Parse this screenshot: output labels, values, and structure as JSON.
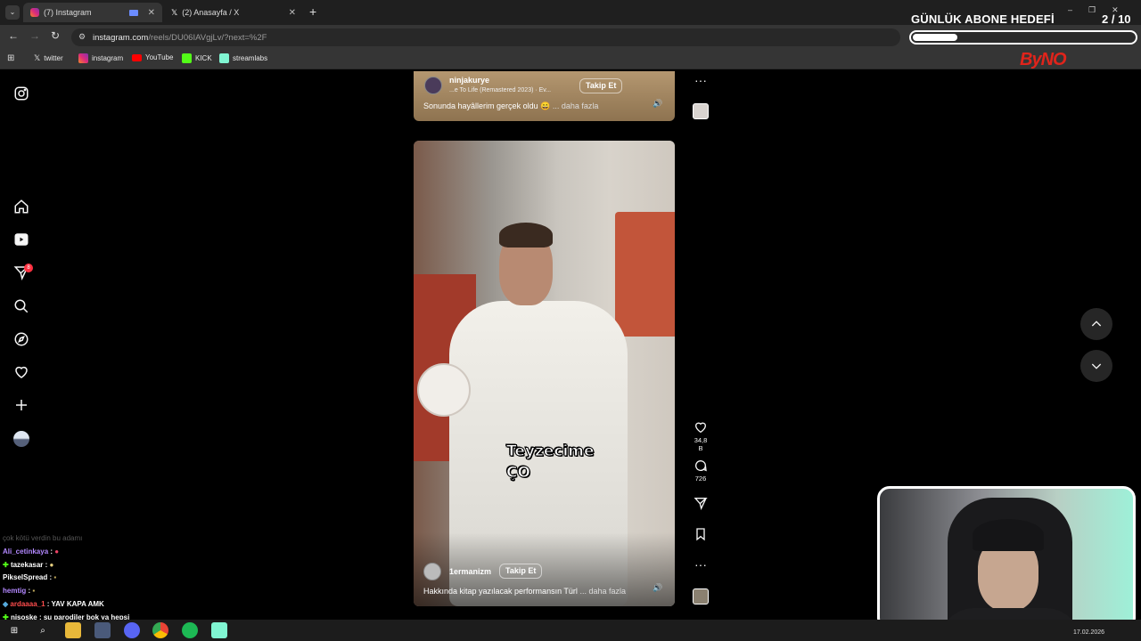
{
  "browser": {
    "tabs": [
      {
        "title": "(7) Instagram",
        "icon": "instagram-icon",
        "active": true
      },
      {
        "title": "(2) Anasayfa / X",
        "icon": "x-icon",
        "active": false
      }
    ],
    "url_host": "instagram.com",
    "url_path": "/reels/DU06IAVgjLv/?next=%2F",
    "bookmarks": [
      {
        "label": "twitter",
        "icon": "x-icon",
        "color": "#000000"
      },
      {
        "label": "instagram",
        "icon": "instagram-icon",
        "color": "#d62976"
      },
      {
        "label": "YouTube",
        "icon": "youtube-icon",
        "color": "#ff0000"
      },
      {
        "label": "KICK",
        "icon": "kick-icon",
        "color": "#53fc18"
      },
      {
        "label": "streamlabs",
        "icon": "streamlabs-icon",
        "color": "#80f5d2"
      }
    ]
  },
  "overlay": {
    "goal_title": "GÜNLÜK ABONE HEDEFİ",
    "goal_count": "2  / 10",
    "goal_progress": 0.2,
    "logo": "ByNO"
  },
  "sidebar": {
    "notification_count": "8",
    "items": [
      "instagram-logo-icon",
      "home-icon",
      "reels-icon",
      "send-icon",
      "search-icon",
      "explore-icon",
      "heart-icon",
      "plus-icon",
      "profile-avatar"
    ]
  },
  "reel_top": {
    "author": "ninjakurye",
    "audio": "...e To Life (Remastered 2023) · Ev...",
    "follow_label": "Takip Et",
    "caption": "Sonunda hayâllerim gerçek oldu 😄",
    "more_label": "... daha fazla"
  },
  "reel_main": {
    "author": "1ermanizm",
    "follow_label": "Takip Et",
    "caption": "Hakkında kitap yazılacak performansın Türl",
    "more_label": "... daha fazla",
    "subtitle_line1": "Teyzecime",
    "subtitle_line2": "ÇO",
    "likes": "34,8 B",
    "comments": "726"
  },
  "chat": [
    {
      "user": "",
      "text": "çok kötü verdin bu adamı",
      "faded": true
    },
    {
      "user": "Ali_cetinkaya",
      "text": "",
      "color": "#b388ff"
    },
    {
      "user": "tazekasar",
      "text": "",
      "color": "#ffffff"
    },
    {
      "user": "PikselSpread",
      "text": "",
      "color": "#ffffff"
    },
    {
      "user": "hemtig",
      "text": "",
      "color": "#b388ff"
    },
    {
      "user": "ardaaaa_1",
      "text": "YAV KAPA AMK",
      "color": "#ff4d4d"
    },
    {
      "user": "nisoske",
      "text": "şu parodiler bok ya hepsi",
      "color": "#ffffff"
    }
  ],
  "taskbar": {
    "date": "17.02.2026"
  },
  "colors": {
    "instagram_bg": "#000000",
    "badge": "#ff3040",
    "accent_logo": "#e0241b"
  }
}
